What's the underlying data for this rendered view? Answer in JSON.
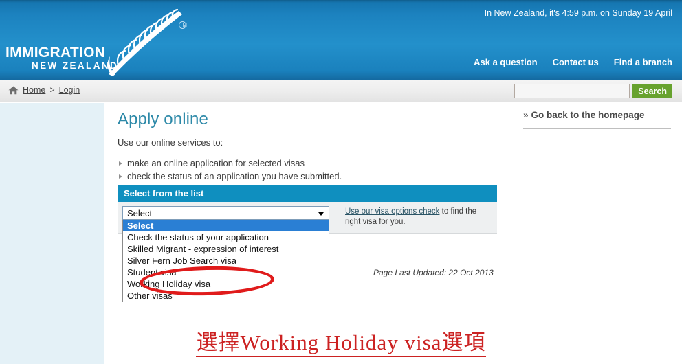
{
  "header": {
    "logo_line1": "IMMIGRATION",
    "logo_line2": "NEW ZEALAND",
    "trademark": "TM",
    "time_notice": "In New Zealand, it's 4:59 p.m. on Sunday 19 April",
    "links": [
      {
        "label": "Ask a question"
      },
      {
        "label": "Contact us"
      },
      {
        "label": "Find a branch"
      }
    ]
  },
  "breadcrumb": {
    "home": "Home",
    "separator": ">",
    "current": "Login"
  },
  "search": {
    "value": "",
    "placeholder": "",
    "button_label": "Search"
  },
  "main": {
    "title": "Apply online",
    "lead": "Use our online services to:",
    "bullets": [
      "make an online application for selected visas",
      "check the status of an application you have submitted."
    ],
    "last_updated": "Page Last Updated: 22 Oct 2013"
  },
  "panel": {
    "heading": "Select from the list",
    "select_value": "Select",
    "options": [
      "Select",
      "Check the status of your application",
      "Skilled Migrant - expression of interest",
      "Silver Fern Job Search visa",
      "Student visa",
      "Working Holiday visa",
      "Other visas"
    ],
    "selected_index": 0,
    "help_link": "Use our visa options check",
    "help_text": " to find the right visa for you."
  },
  "right_column": {
    "go_home_chevron": "»",
    "go_home_label": "Go back to the homepage"
  },
  "annotations": {
    "caption": "選擇Working Holiday visa選項",
    "highlight_color": "#e01b1b",
    "caption_color": "#cc2222",
    "circled_option": "Working Holiday visa"
  }
}
